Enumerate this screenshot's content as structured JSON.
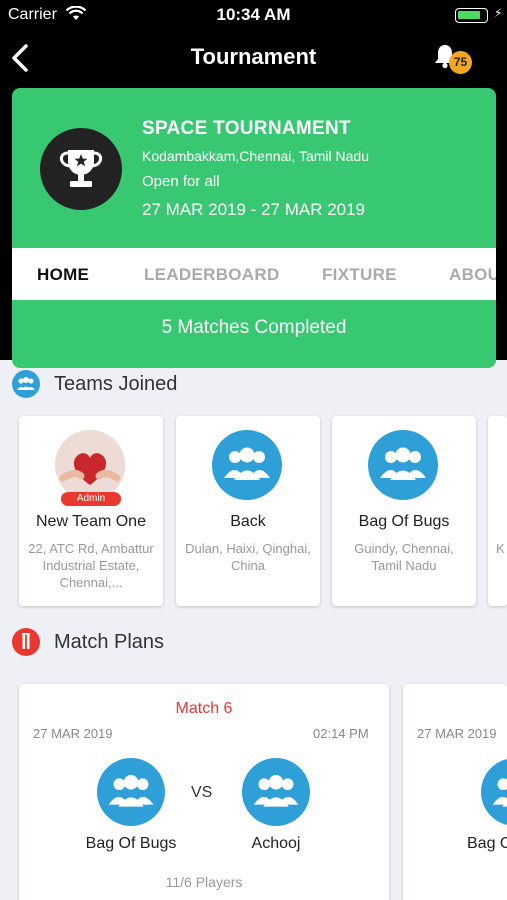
{
  "status_bar": {
    "carrier": "Carrier",
    "time": "10:34 AM",
    "battery_level": 0.85
  },
  "header": {
    "title": "Tournament",
    "notification_count": "75"
  },
  "tournament": {
    "name": "SPACE TOURNAMENT",
    "location": "Kodambakkam,Chennai, Tamil Nadu",
    "eligibility": "Open for all",
    "dates": "27 MAR 2019 - 27 MAR 2019",
    "tabs": [
      "HOME",
      "LEADERBOARD",
      "FIXTURE",
      "ABOUT"
    ],
    "active_tab": "HOME",
    "matches_completed": "5 Matches Completed"
  },
  "teams_section": {
    "title": "Teams Joined",
    "teams": [
      {
        "name": "New Team One",
        "address": "22, ATC Rd, Ambattur Industrial Estate, Chennai,...",
        "badge": "Admin",
        "avatar": "heart-photo"
      },
      {
        "name": "Back",
        "address": "Dulan, Haixi, Qinghai, China",
        "avatar": "group-icon"
      },
      {
        "name": "Bag Of Bugs",
        "address": "Guindy, Chennai, Tamil Nadu",
        "avatar": "group-icon"
      },
      {
        "name": "",
        "address": "K",
        "avatar": "group-icon"
      }
    ]
  },
  "match_section": {
    "title": "Match Plans",
    "matches": [
      {
        "label": "Match 6",
        "date": "27 MAR 2019",
        "time": "02:14 PM",
        "team_a": "Bag Of Bugs",
        "team_b": "Achooj",
        "vs": "VS",
        "players": "11/6 Players"
      },
      {
        "date": "27 MAR 2019",
        "team_a": "Bag O"
      }
    ]
  },
  "colors": {
    "accent_green": "#37c871",
    "icon_blue": "#2f9fd8",
    "alert_red": "#e8382f",
    "badge_orange": "#f5a623"
  }
}
